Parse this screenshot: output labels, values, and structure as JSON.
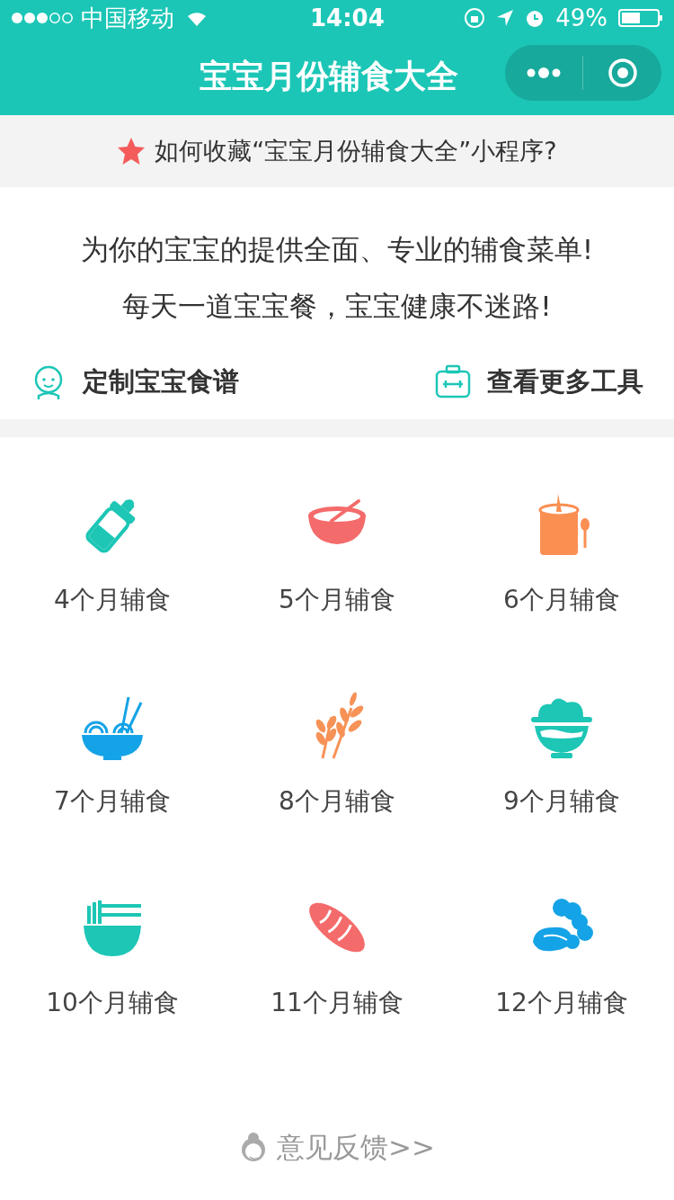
{
  "status_bar": {
    "carrier": "中国移动",
    "time": "14:04",
    "battery": "49%"
  },
  "nav": {
    "title": "宝宝月份辅食大全"
  },
  "banner": {
    "text": "如何收藏“宝宝月份辅食大全”小程序?"
  },
  "intro": {
    "lines": [
      "为你的宝宝的提供全面、专业的辅食菜单!",
      "每天一道宝宝餐，宝宝健康不迷路!"
    ]
  },
  "links": [
    {
      "kind": "baby",
      "label": "定制宝宝食谱"
    },
    {
      "kind": "toolbox",
      "label": "查看更多工具"
    }
  ],
  "items": [
    {
      "kind": "bottle",
      "color": "#1dc6b5",
      "label": "4个月辅食"
    },
    {
      "kind": "bowl",
      "color": "#f46b6b",
      "label": "5个月辅食"
    },
    {
      "kind": "can",
      "color": "#fa8f52",
      "label": "6个月辅食"
    },
    {
      "kind": "noodle",
      "color": "#14a3e6",
      "label": "7个月辅食"
    },
    {
      "kind": "wheat",
      "color": "#f79257",
      "label": "8个月辅食"
    },
    {
      "kind": "rice",
      "color": "#1dc6b5",
      "label": "9个月辅食"
    },
    {
      "kind": "ramen",
      "color": "#1dc6b5",
      "label": "10个月辅食"
    },
    {
      "kind": "bread",
      "color": "#f46b6b",
      "label": "11个月辅食"
    },
    {
      "kind": "veg",
      "color": "#14a3e6",
      "label": "12个月辅食"
    }
  ],
  "feedback": {
    "label": "意见反馈>>"
  }
}
